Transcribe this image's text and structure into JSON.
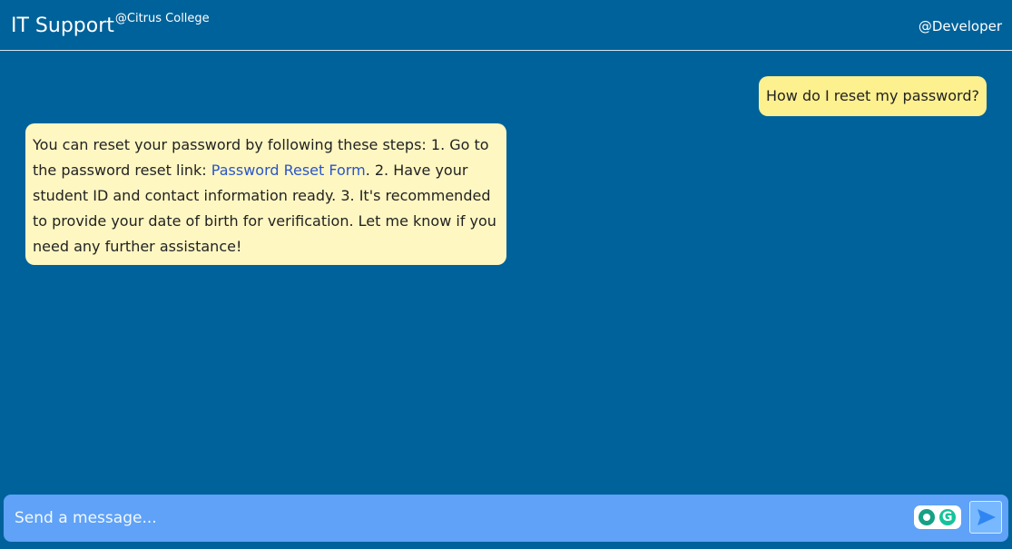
{
  "header": {
    "title": "IT Support",
    "subtitle": "@Citrus College",
    "user": "@Developer"
  },
  "chat": {
    "messages": [
      {
        "role": "user",
        "text": "How do I reset my password?"
      },
      {
        "role": "assistant",
        "text_before_link": "You can reset your password by following these steps: 1. Go to the password reset link: ",
        "link_text": "Password Reset Form",
        "text_after_link": ". 2. Have your student ID and contact information ready. 3. It's recommended to provide your date of birth for verification. Let me know if you need any further assistance!"
      }
    ]
  },
  "input": {
    "placeholder": "Send a message...",
    "value": ""
  },
  "icons": {
    "send": "send-arrow-icon",
    "grammarly": "grammarly-icon",
    "grammarly_extra": "plus-badge-icon"
  },
  "colors": {
    "background": "#00629a",
    "header_text": "#ffffff",
    "message_bubble": "#fff7c2",
    "user_bubble": "#fdf08f",
    "link": "#2a55c8",
    "input_bar": "#5fa2f7"
  }
}
